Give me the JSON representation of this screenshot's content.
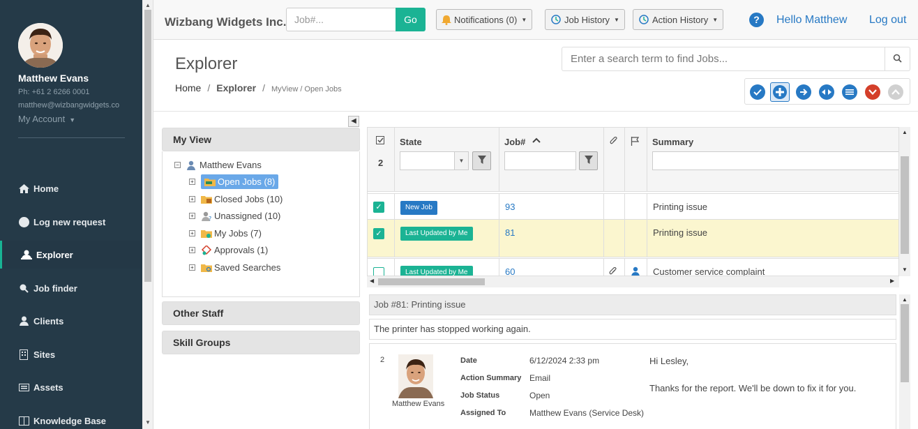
{
  "user": {
    "name": "Matthew Evans",
    "phone": "Ph: +61 2 6266 0001",
    "email": "matthew@wizbangwidgets.co",
    "account_label": "My Account"
  },
  "nav": [
    {
      "label": "Home",
      "icon": "home-icon"
    },
    {
      "label": "Log new request",
      "icon": "circle-icon"
    },
    {
      "label": "Explorer",
      "icon": "explorer-icon"
    },
    {
      "label": "Job finder",
      "icon": "search-icon"
    },
    {
      "label": "Clients",
      "icon": "person-icon"
    },
    {
      "label": "Sites",
      "icon": "building-icon"
    },
    {
      "label": "Assets",
      "icon": "keyboard-icon"
    },
    {
      "label": "Knowledge Base",
      "icon": "book-icon"
    }
  ],
  "topbar": {
    "brand": "Wizbang Widgets Inc.",
    "job_placeholder": "Job#...",
    "go_label": "Go",
    "notifications": "Notifications (0)",
    "job_history": "Job History",
    "action_history": "Action History",
    "hello": "Hello Matthew",
    "logout": "Log out"
  },
  "page": {
    "title": "Explorer",
    "breadcrumb": {
      "home": "Home",
      "current": "Explorer",
      "path": "MyView / Open Jobs"
    },
    "search_placeholder": "Enter a search term to find Jobs..."
  },
  "colors": {
    "accent": "#1bb394",
    "link": "#2779c4",
    "sidebar": "#253a48",
    "selected_row": "#fbf6cf"
  },
  "left": {
    "my_view": "My View",
    "tree_root": "Matthew Evans",
    "tree": [
      {
        "label": "Open Jobs (8)",
        "selected": true
      },
      {
        "label": "Closed Jobs (10)"
      },
      {
        "label": "Unassigned (10)"
      },
      {
        "label": "My Jobs (7)"
      },
      {
        "label": "Approvals (1)"
      },
      {
        "label": "Saved Searches"
      }
    ],
    "other_staff": "Other Staff",
    "skill_groups": "Skill Groups"
  },
  "grid": {
    "selected_count": "2",
    "columns": {
      "state": "State",
      "job": "Job#",
      "summary": "Summary"
    },
    "rows": [
      {
        "checked": true,
        "state": "New Job",
        "state_color": "#2779c4",
        "job": "93",
        "summary": "Printing issue"
      },
      {
        "checked": true,
        "state": "Last Updated by Me",
        "state_color": "#1bb394",
        "job": "81",
        "summary": "Printing issue"
      },
      {
        "checked": false,
        "state": "Last Updated by Me",
        "state_color": "#1bb394",
        "job": "60",
        "summary": "Customer service complaint"
      }
    ]
  },
  "detail": {
    "title": "Job #81: Printing issue",
    "description": "The printer has stopped working again.",
    "action": {
      "number": "2",
      "author": "Matthew Evans",
      "fields": [
        {
          "k": "Date",
          "v": "6/12/2024 2:33 pm"
        },
        {
          "k": "Action Summary",
          "v": "Email"
        },
        {
          "k": "Job Status",
          "v": "Open"
        },
        {
          "k": "Assigned To",
          "v": "Matthew Evans (Service Desk)"
        }
      ],
      "greeting": "Hi Lesley,",
      "message": "Thanks for the report.  We'll be down to fix it for you."
    }
  }
}
